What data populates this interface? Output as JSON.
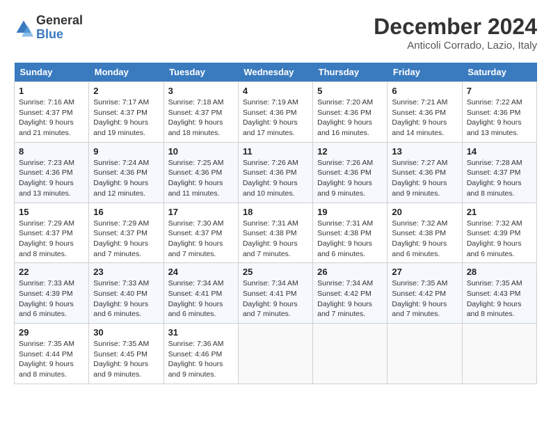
{
  "header": {
    "logo_line1": "General",
    "logo_line2": "Blue",
    "month_title": "December 2024",
    "location": "Anticoli Corrado, Lazio, Italy"
  },
  "days_of_week": [
    "Sunday",
    "Monday",
    "Tuesday",
    "Wednesday",
    "Thursday",
    "Friday",
    "Saturday"
  ],
  "weeks": [
    [
      {
        "day": "1",
        "info": "Sunrise: 7:16 AM\nSunset: 4:37 PM\nDaylight: 9 hours and 21 minutes."
      },
      {
        "day": "2",
        "info": "Sunrise: 7:17 AM\nSunset: 4:37 PM\nDaylight: 9 hours and 19 minutes."
      },
      {
        "day": "3",
        "info": "Sunrise: 7:18 AM\nSunset: 4:37 PM\nDaylight: 9 hours and 18 minutes."
      },
      {
        "day": "4",
        "info": "Sunrise: 7:19 AM\nSunset: 4:36 PM\nDaylight: 9 hours and 17 minutes."
      },
      {
        "day": "5",
        "info": "Sunrise: 7:20 AM\nSunset: 4:36 PM\nDaylight: 9 hours and 16 minutes."
      },
      {
        "day": "6",
        "info": "Sunrise: 7:21 AM\nSunset: 4:36 PM\nDaylight: 9 hours and 14 minutes."
      },
      {
        "day": "7",
        "info": "Sunrise: 7:22 AM\nSunset: 4:36 PM\nDaylight: 9 hours and 13 minutes."
      }
    ],
    [
      {
        "day": "8",
        "info": "Sunrise: 7:23 AM\nSunset: 4:36 PM\nDaylight: 9 hours and 13 minutes."
      },
      {
        "day": "9",
        "info": "Sunrise: 7:24 AM\nSunset: 4:36 PM\nDaylight: 9 hours and 12 minutes."
      },
      {
        "day": "10",
        "info": "Sunrise: 7:25 AM\nSunset: 4:36 PM\nDaylight: 9 hours and 11 minutes."
      },
      {
        "day": "11",
        "info": "Sunrise: 7:26 AM\nSunset: 4:36 PM\nDaylight: 9 hours and 10 minutes."
      },
      {
        "day": "12",
        "info": "Sunrise: 7:26 AM\nSunset: 4:36 PM\nDaylight: 9 hours and 9 minutes."
      },
      {
        "day": "13",
        "info": "Sunrise: 7:27 AM\nSunset: 4:36 PM\nDaylight: 9 hours and 9 minutes."
      },
      {
        "day": "14",
        "info": "Sunrise: 7:28 AM\nSunset: 4:37 PM\nDaylight: 9 hours and 8 minutes."
      }
    ],
    [
      {
        "day": "15",
        "info": "Sunrise: 7:29 AM\nSunset: 4:37 PM\nDaylight: 9 hours and 8 minutes."
      },
      {
        "day": "16",
        "info": "Sunrise: 7:29 AM\nSunset: 4:37 PM\nDaylight: 9 hours and 7 minutes."
      },
      {
        "day": "17",
        "info": "Sunrise: 7:30 AM\nSunset: 4:37 PM\nDaylight: 9 hours and 7 minutes."
      },
      {
        "day": "18",
        "info": "Sunrise: 7:31 AM\nSunset: 4:38 PM\nDaylight: 9 hours and 7 minutes."
      },
      {
        "day": "19",
        "info": "Sunrise: 7:31 AM\nSunset: 4:38 PM\nDaylight: 9 hours and 6 minutes."
      },
      {
        "day": "20",
        "info": "Sunrise: 7:32 AM\nSunset: 4:38 PM\nDaylight: 9 hours and 6 minutes."
      },
      {
        "day": "21",
        "info": "Sunrise: 7:32 AM\nSunset: 4:39 PM\nDaylight: 9 hours and 6 minutes."
      }
    ],
    [
      {
        "day": "22",
        "info": "Sunrise: 7:33 AM\nSunset: 4:39 PM\nDaylight: 9 hours and 6 minutes."
      },
      {
        "day": "23",
        "info": "Sunrise: 7:33 AM\nSunset: 4:40 PM\nDaylight: 9 hours and 6 minutes."
      },
      {
        "day": "24",
        "info": "Sunrise: 7:34 AM\nSunset: 4:41 PM\nDaylight: 9 hours and 6 minutes."
      },
      {
        "day": "25",
        "info": "Sunrise: 7:34 AM\nSunset: 4:41 PM\nDaylight: 9 hours and 7 minutes."
      },
      {
        "day": "26",
        "info": "Sunrise: 7:34 AM\nSunset: 4:42 PM\nDaylight: 9 hours and 7 minutes."
      },
      {
        "day": "27",
        "info": "Sunrise: 7:35 AM\nSunset: 4:42 PM\nDaylight: 9 hours and 7 minutes."
      },
      {
        "day": "28",
        "info": "Sunrise: 7:35 AM\nSunset: 4:43 PM\nDaylight: 9 hours and 8 minutes."
      }
    ],
    [
      {
        "day": "29",
        "info": "Sunrise: 7:35 AM\nSunset: 4:44 PM\nDaylight: 9 hours and 8 minutes."
      },
      {
        "day": "30",
        "info": "Sunrise: 7:35 AM\nSunset: 4:45 PM\nDaylight: 9 hours and 9 minutes."
      },
      {
        "day": "31",
        "info": "Sunrise: 7:36 AM\nSunset: 4:46 PM\nDaylight: 9 hours and 9 minutes."
      },
      null,
      null,
      null,
      null
    ]
  ]
}
